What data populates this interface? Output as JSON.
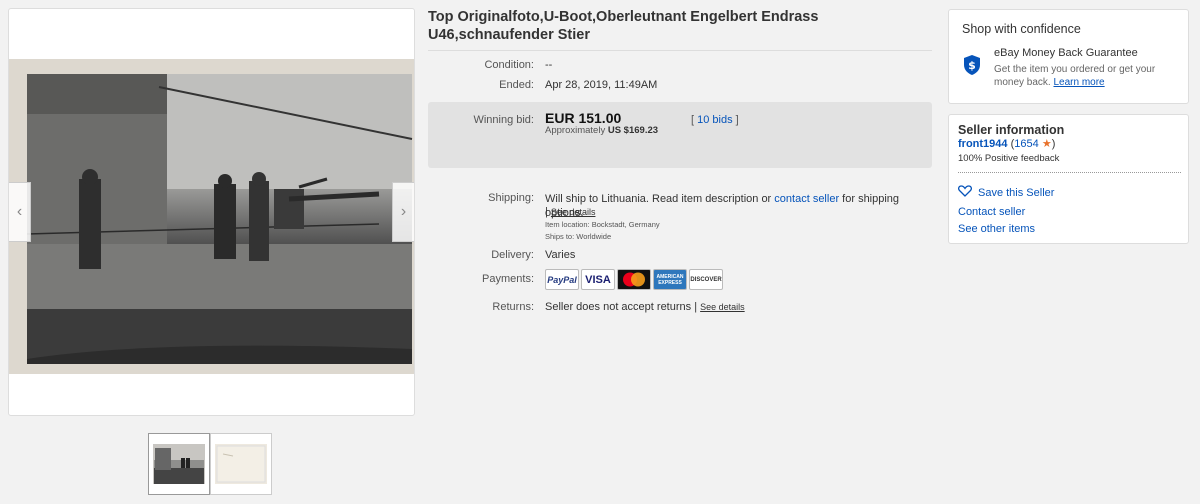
{
  "item": {
    "title": "Top Originalfoto,U-Boot,Oberleutnant Engelbert Endrass U46,schnaufender Stier"
  },
  "details": {
    "condition_label": "Condition:",
    "condition_value": "--",
    "ended_label": "Ended:",
    "ended_value": "Apr 28, 2019, 11:49AM",
    "winning_label": "Winning bid:",
    "price": "EUR 151.00",
    "approx_prefix": "Approximately",
    "approx_value": "US $169.23",
    "bids_open": "[",
    "bids_link": "10 bids",
    "bids_close": "]",
    "shipping_label": "Shipping:",
    "shipping_text_a": "Will ship to Lithuania. Read item description or",
    "shipping_link": "contact seller",
    "shipping_text_b": "for shipping options.",
    "shipping_sep": "|",
    "see_details": "See details",
    "item_location": "Item location:  Bockstadt, Germany",
    "ships_to": "Ships to:  Worldwide",
    "delivery_label": "Delivery:",
    "delivery_value": "Varies",
    "payments_label": "Payments:",
    "returns_label": "Returns:",
    "returns_value": "Seller does not accept returns |",
    "returns_link": "See details"
  },
  "payments": [
    "PayPal",
    "VISA",
    "MasterCard",
    "AMERICAN EXPRESS",
    "DISCOVER"
  ],
  "confidence": {
    "title": "Shop with confidence",
    "mbg_title": "eBay Money Back Guarantee",
    "mbg_desc": "Get the item you ordered or get your money back.",
    "learn_more": "Learn more",
    "accent": "#0654ba"
  },
  "seller": {
    "title": "Seller information",
    "name": "front1944",
    "score": "1654",
    "paren_open": "(",
    "paren_close": ")",
    "feedback": "100% Positive feedback",
    "save": "Save this Seller",
    "contact": "Contact seller",
    "other": "See other items"
  },
  "gallery": {
    "prev_icon": "chevron-left-icon",
    "next_icon": "chevron-right-icon"
  }
}
